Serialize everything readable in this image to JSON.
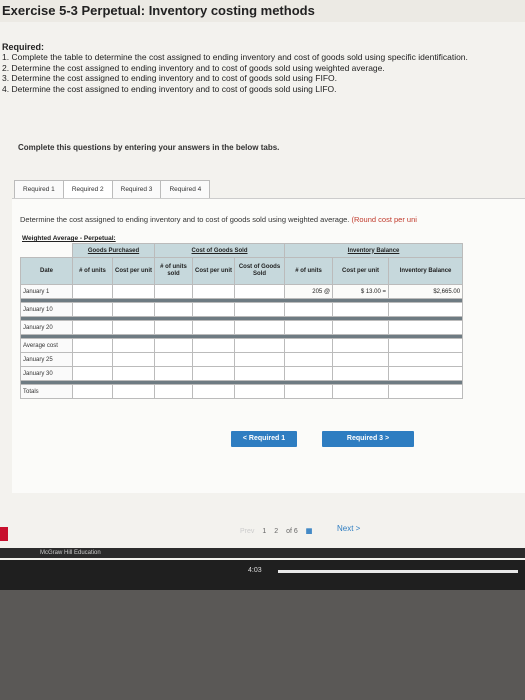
{
  "header": {
    "title": "Exercise 5-3 Perpetual: Inventory costing methods"
  },
  "requirements": {
    "heading": "Required:",
    "items": [
      "1. Complete the table to determine the cost assigned to ending inventory and cost of goods sold using specific identification.",
      "2. Determine the cost assigned to ending inventory and to cost of goods sold using weighted average.",
      "3. Determine the cost assigned to ending inventory and to cost of goods sold using FIFO.",
      "4. Determine the cost assigned to ending inventory and to cost of goods sold using LIFO."
    ]
  },
  "instruction": "Complete this questions by entering your answers in the below tabs.",
  "tabs": [
    {
      "label": "Required 1"
    },
    {
      "label": "Required 2"
    },
    {
      "label": "Required 3"
    },
    {
      "label": "Required 4"
    }
  ],
  "question": {
    "text": "Determine the cost assigned to ending inventory and to cost of goods sold using weighted average.",
    "hint": "(Round cost per uni"
  },
  "table": {
    "caption": "Weighted Average - Perpetual:",
    "groups": {
      "purchased": "Goods Purchased",
      "sold": "Cost of Goods Sold",
      "balance": "Inventory Balance"
    },
    "columns": {
      "date": "Date",
      "p_units": "# of units",
      "p_cost": "Cost per unit",
      "s_units": "# of units sold",
      "s_cost": "Cost per unit",
      "s_total": "Cost of Goods Sold",
      "b_units": "# of units",
      "b_cost": "Cost per unit",
      "b_total": "Inventory Balance"
    },
    "rows": {
      "jan1": {
        "label": "January 1",
        "b_units": "205",
        "b_cost": "$ 13.00",
        "b_total": "$2,665.00"
      },
      "jan10": {
        "label": "January 10"
      },
      "jan20": {
        "label": "January 20"
      },
      "avg": {
        "label": "Average cost"
      },
      "jan25": {
        "label": "January 25"
      },
      "jan30": {
        "label": "January 30"
      },
      "totals": {
        "label": "Totals"
      }
    }
  },
  "nav": {
    "prev": "< Required 1",
    "next": "Required 3 >"
  },
  "pager": {
    "prev": "Prev",
    "current": "1",
    "next_page": "2",
    "of": "of 6",
    "next": "Next >"
  },
  "footer": {
    "brand": "McGraw Hill Education",
    "time": "4:03"
  }
}
